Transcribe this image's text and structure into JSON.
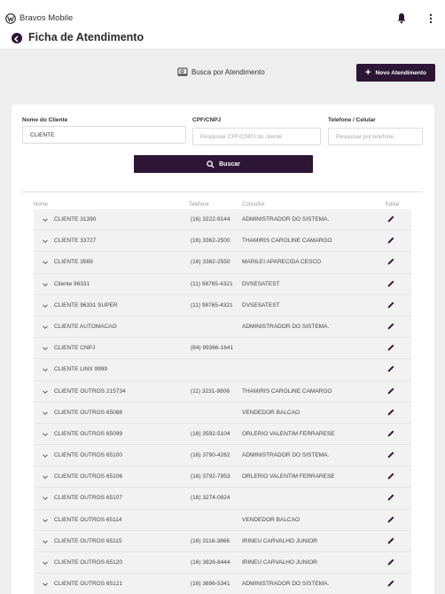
{
  "app": {
    "name": "Bravos Mobile"
  },
  "page": {
    "title": "Ficha de Atendimento"
  },
  "actions": {
    "search_label": "Busca por Atendimento",
    "new_label": "Novo Atendimento"
  },
  "filters": {
    "client": {
      "label": "Nome do Cliente",
      "value": "CLIENTE",
      "placeholder": ""
    },
    "doc": {
      "label": "CPF/CNPJ",
      "value": "",
      "placeholder": "Pesquisar CPF/CNPJ do cliente"
    },
    "phone": {
      "label": "Telefone / Celular",
      "value": "",
      "placeholder": "Pesquisar por telefone"
    },
    "search_button": "Buscar"
  },
  "table": {
    "headers": {
      "name": "Nome",
      "phone": "Telefone",
      "consultant": "Consultor",
      "edit": "Editar"
    },
    "rows": [
      {
        "name": "CLIENTE 31390",
        "phone": "(16) 3222-9144",
        "consultant": "ADMINISTRADOR DO SISTEMA."
      },
      {
        "name": "CLIENTE 33727",
        "phone": "(16) 3362-2500",
        "consultant": "THAMIRIS CAROLINE CAMARGO"
      },
      {
        "name": "CLIENTE 3569",
        "phone": "(16) 3362-2550",
        "consultant": "MARILEI APARECIDA CESCO"
      },
      {
        "name": "Cliente 96331",
        "phone": "(11) 98765-4321",
        "consultant": "DVSESATEST"
      },
      {
        "name": "CLIENTE 96331 SUPER",
        "phone": "(11) 98765-4321",
        "consultant": "DVSESATEST"
      },
      {
        "name": "CLIENTE AUTOMACAO",
        "phone": "",
        "consultant": "ADMINISTRADOR DO SISTEMA."
      },
      {
        "name": "CLIENTE CNPJ",
        "phone": "(84) 99366-1641",
        "consultant": ""
      },
      {
        "name": "CLIENTE LINX 9999",
        "phone": "",
        "consultant": ""
      },
      {
        "name": "CLIENTE OUTROS 215734",
        "phone": "(11) 3231-9806",
        "consultant": "THAMIRIS CAROLINE CAMARGO"
      },
      {
        "name": "CLIENTE OUTROS 65088",
        "phone": "",
        "consultant": "VENDEDOR BALCAO"
      },
      {
        "name": "CLIENTE OUTROS 65099",
        "phone": "(16) 3592-5104",
        "consultant": "ORLERIO VALENTIM FERRARESE"
      },
      {
        "name": "CLIENTE OUTROS 65100",
        "phone": "(16) 3790-4262",
        "consultant": "ADMINISTRADOR DO SISTEMA."
      },
      {
        "name": "CLIENTE OUTROS 65106",
        "phone": "(16) 3792-7953",
        "consultant": "ORLERIO VALENTIM FERRARESE"
      },
      {
        "name": "CLIENTE OUTROS 65107",
        "phone": "(16) 3274-0924",
        "consultant": ""
      },
      {
        "name": "CLIENTE OUTROS 65114",
        "phone": "",
        "consultant": "VENDEDOR BALCAO"
      },
      {
        "name": "CLIENTE OUTROS 65115",
        "phone": "(16) 3116-3866",
        "consultant": "IRINEU CARVALHO JUNIOR"
      },
      {
        "name": "CLIENTE OUTROS 65120",
        "phone": "(16) 3826-8444",
        "consultant": "IRINEU CARVALHO JUNIOR"
      },
      {
        "name": "CLIENTE OUTROS 65121",
        "phone": "(16) 3696-5341",
        "consultant": "ADMINISTRADOR DO SISTEMA."
      }
    ]
  },
  "colors": {
    "accent": "#2d1536",
    "background": "#eeeeee",
    "row": "#f2f2f2"
  },
  "icons": {
    "logo": "vw-logo-icon",
    "notification": "bell-icon",
    "menu": "kebab-menu-icon",
    "back": "back-arrow-icon",
    "search": "search-icon",
    "tablet": "tablet-icon",
    "add": "plus-icon",
    "expand": "chevron-down-icon",
    "edit": "pencil-icon"
  }
}
